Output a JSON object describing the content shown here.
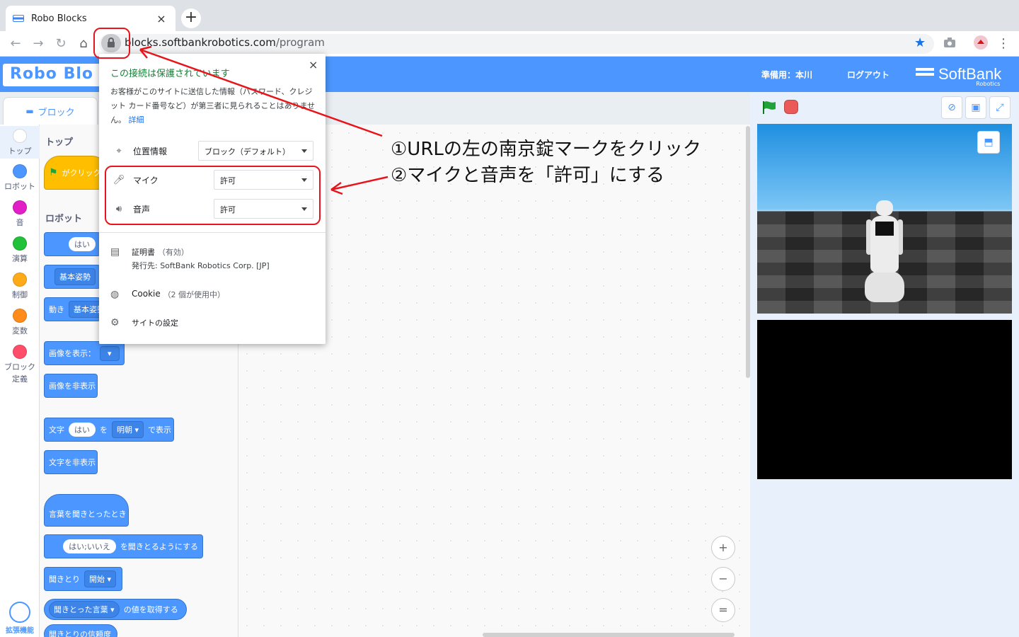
{
  "browser": {
    "tab_title": "Robo Blocks",
    "tab_close": "×",
    "new_tab": "+",
    "url_host": "blocks.softbankrobotics.com",
    "url_path": "/program"
  },
  "header": {
    "logo": "Robo Blo",
    "user": "準備用：本川",
    "logout": "ログアウト",
    "brand": "SoftBank",
    "brand_sub": "Robotics"
  },
  "palette": {
    "tab_label": "ブロック",
    "categories": [
      {
        "label": "トップ",
        "color": "#ffffff"
      },
      {
        "label": "ロボット",
        "color": "#4c97ff"
      },
      {
        "label": "音",
        "color": "#e21ec7"
      },
      {
        "label": "演算",
        "color": "#22c13a"
      },
      {
        "label": "制御",
        "color": "#ffab19"
      },
      {
        "label": "変数",
        "color": "#ff8c1a"
      },
      {
        "label": "ブロック",
        "label2": "定義",
        "color": "#ff4d6a"
      }
    ],
    "extension_label": "拡張機能",
    "section_top": "トップ",
    "section_robot": "ロボット",
    "blocks": {
      "when_flag": "がクリック",
      "say_pill": "はい",
      "basic1": "基本姿勢",
      "move_prefix": "動き",
      "basic2": "基本姿勢",
      "show_image": "画像を表示：",
      "hide_image": "画像を非表示",
      "text_prefix": "文字",
      "text_pill": "はい",
      "text_wo": "を",
      "text_font": "明朝",
      "text_suffix": "で表示",
      "hide_text": "文字を非表示",
      "when_heard": "言葉を聞きとったとき",
      "listen_pill": "はい;いいえ",
      "listen_suffix": "を聞きとるようにする",
      "listen_prefix": "聞きとり",
      "listen_start": "開始",
      "heard_word": "聞きとった言葉",
      "heard_suffix": "の値を取得する",
      "confidence": "聞きとりの信頼度"
    }
  },
  "script_area": {
    "zoom_in": "+",
    "zoom_out": "−",
    "zoom_reset": "="
  },
  "popup": {
    "title": "この接続は保護されています",
    "close": "×",
    "desc": "お客様がこのサイトに送信した情報（パスワード、クレジット カード番号など）が第三者に見られることはありません。",
    "details_link": "詳細",
    "location_label": "位置情報",
    "location_value": "ブロック（デフォルト）",
    "mic_label": "マイク",
    "mic_value": "許可",
    "sound_label": "音声",
    "sound_value": "許可",
    "cert_label": "証明書",
    "cert_status": "（有効）",
    "cert_issuer": "発行先: SoftBank Robotics Corp. [JP]",
    "cookie_label": "Cookie",
    "cookie_count": "（2 個が使用中）",
    "site_settings": "サイトの設定"
  },
  "annotations": {
    "line1": "①URLの左の南京錠マークをクリック",
    "line2": "②マイクと音声を「許可」にする",
    "color": "#e8141b"
  }
}
